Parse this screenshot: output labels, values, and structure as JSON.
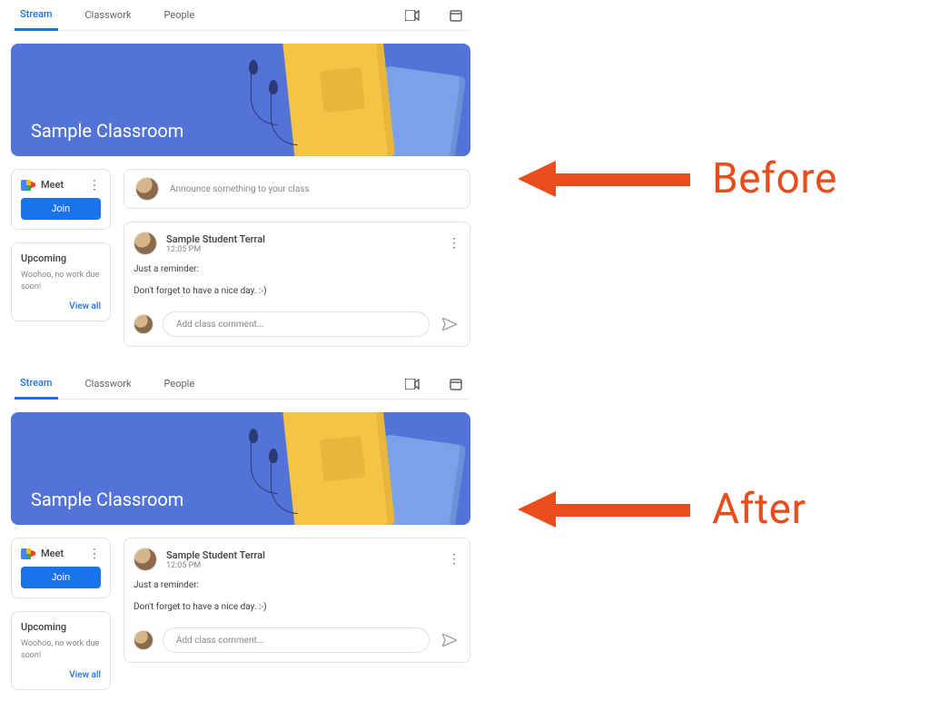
{
  "annotations": {
    "before": "Before",
    "after": "After",
    "color": "#e84d1b"
  },
  "tabs": {
    "items": [
      "Stream",
      "Classwork",
      "People"
    ],
    "active": 0
  },
  "hero": {
    "title": "Sample Classroom"
  },
  "meet": {
    "label": "Meet",
    "join": "Join"
  },
  "upcoming": {
    "title": "Upcoming",
    "text": "Woohoo, no work due soon!",
    "view_all": "View all"
  },
  "announce": {
    "placeholder": "Announce something to your class"
  },
  "post": {
    "author": "Sample Student Terral",
    "time": "12:05 PM",
    "line1": "Just a reminder:",
    "line2": "Don't forget to have a nice day. :-)"
  },
  "comment": {
    "placeholder": "Add class comment..."
  }
}
